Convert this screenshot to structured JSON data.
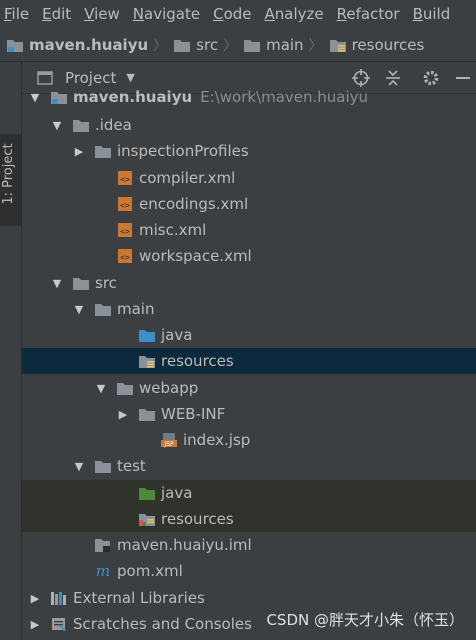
{
  "menubar": {
    "items": [
      "File",
      "Edit",
      "View",
      "Navigate",
      "Code",
      "Analyze",
      "Refactor",
      "Build"
    ]
  },
  "navbar": {
    "crumbs": [
      "maven.huaiyu",
      "src",
      "main",
      "resources"
    ]
  },
  "sidebar": {
    "project_tab": "1: Project"
  },
  "panel": {
    "title": "Project"
  },
  "tree": [
    {
      "label": "maven.huaiyu",
      "path": "E:\\work\\maven.huaiyu",
      "icon": "module-folder-icon",
      "arrow": "down"
    },
    {
      "label": ".idea",
      "icon": "folder-icon",
      "arrow": "down"
    },
    {
      "label": "inspectionProfiles",
      "icon": "folder-icon",
      "arrow": "right"
    },
    {
      "label": "compiler.xml",
      "icon": "xml-file-icon"
    },
    {
      "label": "encodings.xml",
      "icon": "xml-file-icon"
    },
    {
      "label": "misc.xml",
      "icon": "xml-file-icon"
    },
    {
      "label": "workspace.xml",
      "icon": "xml-file-icon"
    },
    {
      "label": "src",
      "icon": "folder-icon",
      "arrow": "down"
    },
    {
      "label": "main",
      "icon": "folder-icon",
      "arrow": "down"
    },
    {
      "label": "java",
      "icon": "source-folder-icon"
    },
    {
      "label": "resources",
      "icon": "resources-folder-icon"
    },
    {
      "label": "webapp",
      "icon": "folder-icon",
      "arrow": "down"
    },
    {
      "label": "WEB-INF",
      "icon": "folder-icon",
      "arrow": "right"
    },
    {
      "label": "index.jsp",
      "icon": "jsp-file-icon"
    },
    {
      "label": "test",
      "icon": "folder-icon",
      "arrow": "down"
    },
    {
      "label": "java",
      "icon": "test-source-folder-icon"
    },
    {
      "label": "resources",
      "icon": "test-resources-folder-icon"
    },
    {
      "label": "maven.huaiyu.iml",
      "icon": "iml-file-icon"
    },
    {
      "label": "pom.xml",
      "icon": "maven-file-icon"
    },
    {
      "label": "External Libraries",
      "icon": "libraries-icon",
      "arrow": "right"
    },
    {
      "label": "Scratches and Consoles",
      "icon": "scratches-icon",
      "arrow": "right"
    }
  ],
  "watermark": "CSDN @胖天才小朱（怀玉）",
  "colors": {
    "background": "#3c3f41",
    "selection": "#0d293e",
    "test_highlight": "#2f332c",
    "folder": "#8a9198",
    "source_folder": "#3d8fc6",
    "test_folder": "#4b8b3b",
    "xml_icon": "#cc7832"
  }
}
